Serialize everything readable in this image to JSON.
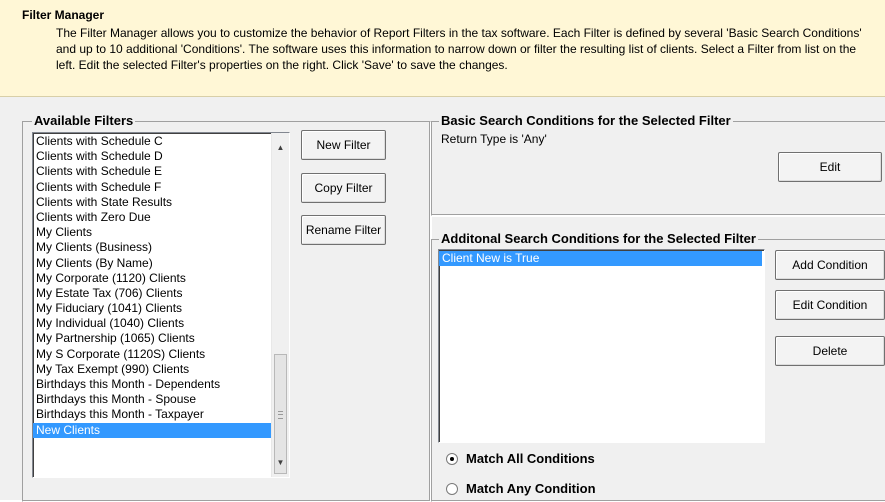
{
  "header": {
    "title": "Filter Manager",
    "description": "The Filter Manager allows you to customize the behavior of Report Filters in the tax software. Each Filter is defined by several 'Basic Search Conditions' and up to 10 additional 'Conditions'. The software uses this information to narrow down or filter the resulting list of clients. Select a Filter from list on the left. Edit the selected Filter's properties on the right. Click 'Save' to save the changes."
  },
  "available_filters": {
    "legend": "Available Filters",
    "items": [
      "Clients with Schedule C",
      "Clients with Schedule D",
      "Clients with Schedule E",
      "Clients with Schedule F",
      "Clients with State Results",
      "Clients with Zero Due",
      "My Clients",
      "My Clients (Business)",
      "My Clients (By Name)",
      "My Corporate (1120) Clients",
      "My Estate Tax (706) Clients",
      "My Fiduciary (1041) Clients",
      "My Individual (1040) Clients",
      "My Partnership (1065) Clients",
      "My S Corporate (1120S) Clients",
      "My Tax Exempt (990) Clients",
      "Birthdays this Month - Dependents",
      "Birthdays this Month - Spouse",
      "Birthdays this Month - Taxpayer",
      "New Clients"
    ],
    "selected": "New Clients",
    "scroll_up_icon": "▲",
    "scroll_down_icon": "▼"
  },
  "filter_buttons": {
    "new": "New Filter",
    "copy": "Copy Filter",
    "rename": "Rename Filter"
  },
  "basic": {
    "legend": "Basic Search Conditions for the Selected Filter",
    "text": "Return Type is 'Any'",
    "edit": "Edit"
  },
  "additional": {
    "legend": "Additonal Search Conditions for the Selected Filter",
    "items": [
      "Client New is True"
    ],
    "selected": "Client New is True",
    "add": "Add Condition",
    "edit": "Edit Condition",
    "delete": "Delete"
  },
  "match": {
    "all_label": "Match All Conditions",
    "any_label": "Match Any Condition",
    "selected": "all"
  }
}
